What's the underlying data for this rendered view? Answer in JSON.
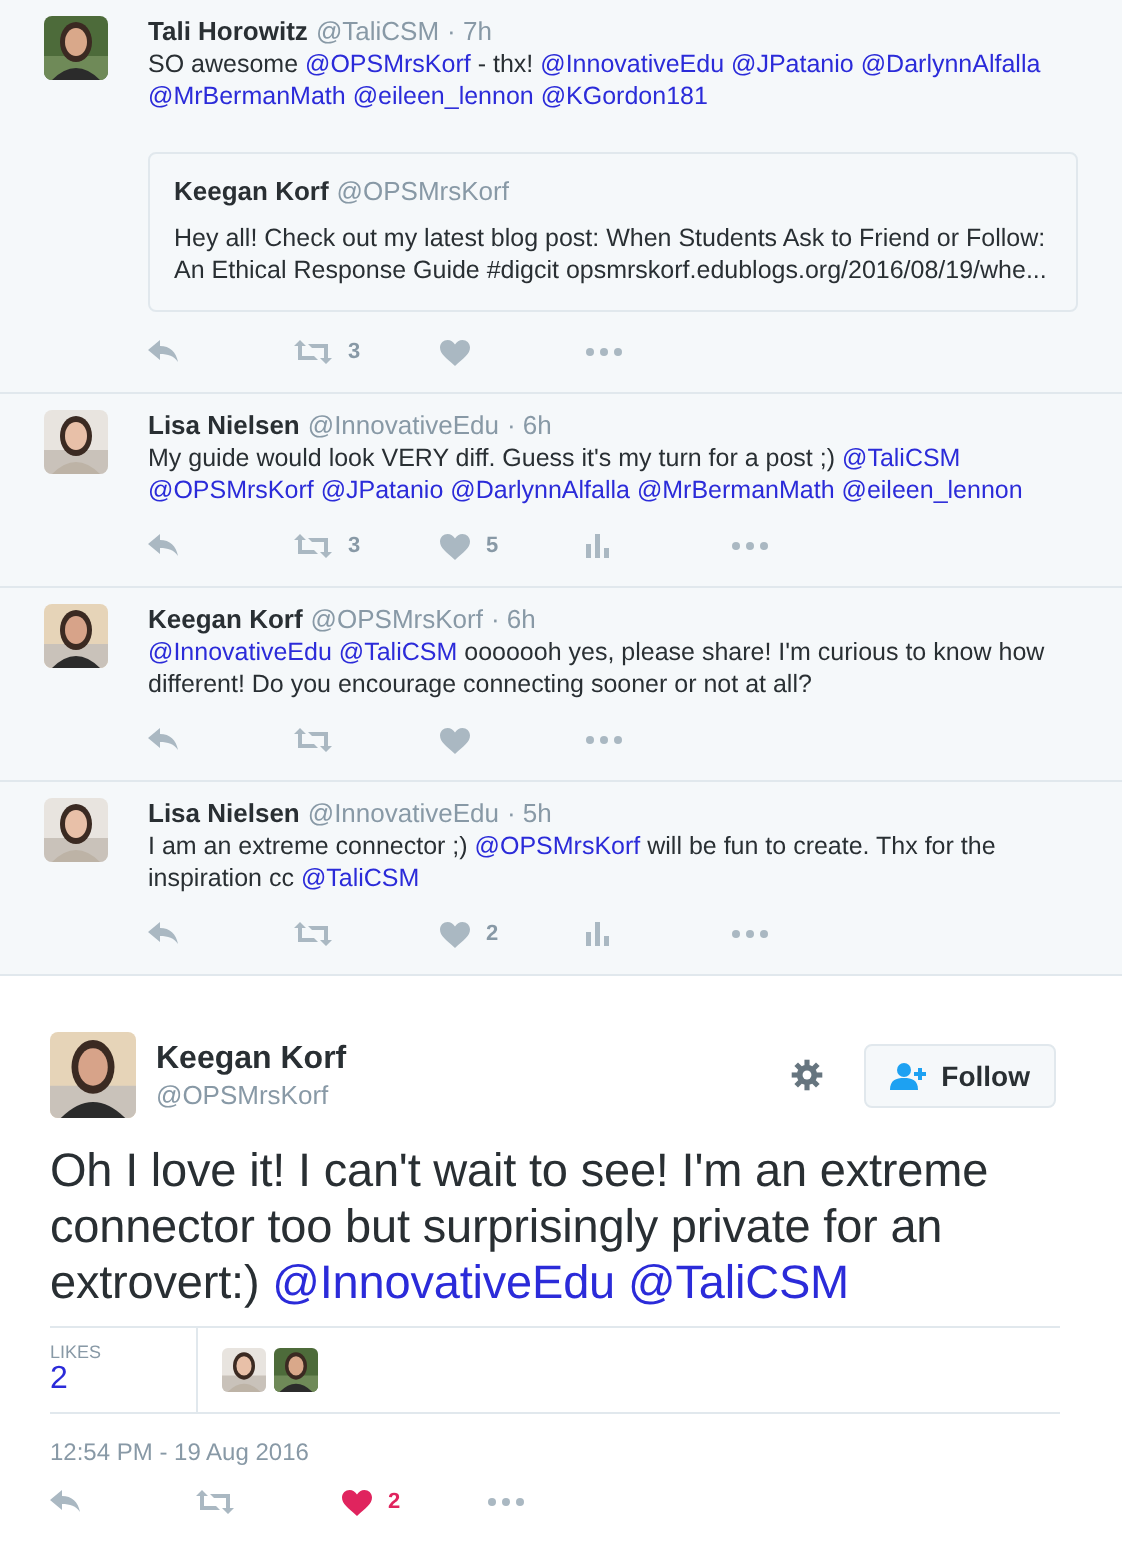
{
  "replies": [
    {
      "name": "Tali Horowitz",
      "handle": "@TaliCSM",
      "time": "· 7h",
      "avatar": {
        "kind": "picture"
      },
      "text": [
        {
          "kind": "text",
          "text": "SO awesome"
        },
        {
          "kind": "mention",
          "text": "@OPSMrsKorf"
        },
        {
          "kind": "text",
          "text": "- thx!"
        },
        {
          "kind": "mention",
          "text": "@InnovativeEdu"
        },
        {
          "kind": "mention",
          "text": "@JPatanio"
        },
        {
          "kind": "mention",
          "text": "@DarlynnAlfalla"
        },
        {
          "kind": "mention",
          "text": "@MrBermanMath"
        },
        {
          "kind": "mention",
          "text": "@eileen_lennon"
        },
        {
          "kind": "mention",
          "text": "@KGordon181"
        }
      ],
      "quote": {
        "name": "Keegan Korf",
        "handle": "@OPSMrsKorf",
        "text": "Hey all! Check out my latest blog post: When Students Ask to Friend or Follow: An Ethical Response Guide #digcit opsmrskorf.edublogs.org/2016/08/19/whe..."
      },
      "actions": [
        {
          "kind": "reply"
        },
        {
          "kind": "retweet",
          "count": "3"
        },
        {
          "kind": "like"
        },
        {
          "kind": "more"
        }
      ]
    },
    {
      "name": "Lisa Nielsen",
      "handle": "@InnovativeEdu",
      "time": "· 6h",
      "avatar": {
        "kind": "picture"
      },
      "text": [
        {
          "kind": "text",
          "text": "My guide would look VERY diff. Guess it's my turn for a post ;)"
        },
        {
          "kind": "mention",
          "text": "@TaliCSM"
        },
        {
          "kind": "mention",
          "text": "@OPSMrsKorf"
        },
        {
          "kind": "mention",
          "text": "@JPatanio"
        },
        {
          "kind": "mention",
          "text": "@DarlynnAlfalla"
        },
        {
          "kind": "mention",
          "text": "@MrBermanMath"
        },
        {
          "kind": "mention",
          "text": "@eileen_lennon"
        }
      ],
      "actions": [
        {
          "kind": "reply"
        },
        {
          "kind": "retweet",
          "count": "3"
        },
        {
          "kind": "like",
          "count": "5"
        },
        {
          "kind": "analytics"
        },
        {
          "kind": "more"
        }
      ]
    },
    {
      "name": "Keegan Korf",
      "handle": "@OPSMrsKorf",
      "time": "· 6h",
      "avatar": {
        "kind": "picture"
      },
      "text": [
        {
          "kind": "mention",
          "text": "@InnovativeEdu"
        },
        {
          "kind": "mention",
          "text": "@TaliCSM"
        },
        {
          "kind": "text",
          "text": "ooooooh yes, please share! I'm curious to know how different! Do you encourage connecting sooner or not at all?"
        }
      ],
      "actions": [
        {
          "kind": "reply"
        },
        {
          "kind": "retweet"
        },
        {
          "kind": "like"
        },
        {
          "kind": "more"
        }
      ]
    },
    {
      "name": "Lisa Nielsen",
      "handle": "@InnovativeEdu",
      "time": "· 5h",
      "avatar": {
        "kind": "picture"
      },
      "text": [
        {
          "kind": "text",
          "text": "I am an extreme connector ;)"
        },
        {
          "kind": "mention",
          "text": "@OPSMrsKorf"
        },
        {
          "kind": "text",
          "text": "will be fun to create. Thx for the inspiration cc"
        },
        {
          "kind": "mention",
          "text": "@TaliCSM"
        }
      ],
      "actions": [
        {
          "kind": "reply"
        },
        {
          "kind": "retweet"
        },
        {
          "kind": "like",
          "count": "2"
        },
        {
          "kind": "analytics"
        },
        {
          "kind": "more"
        }
      ]
    }
  ],
  "main_tweet": {
    "name": "Keegan Korf",
    "handle": "@OPSMrsKorf",
    "avatar": {
      "kind": "picture"
    },
    "follow_button": "Follow",
    "text": [
      {
        "kind": "text",
        "text": "Oh I love it! I can't wait to see! I'm an extreme connector too but surprisingly private for an extrovert:)"
      },
      {
        "kind": "mention",
        "text": "@InnovativeEdu"
      },
      {
        "kind": "mention",
        "text": "@TaliCSM"
      }
    ],
    "likes_label": "LIKES",
    "likes_count": "2",
    "likers": [
      {
        "kind": "picture"
      },
      {
        "kind": "picture"
      }
    ],
    "timestamp": "12:54 PM - 19 Aug 2016",
    "actions": [
      {
        "kind": "reply",
        "on": false
      },
      {
        "kind": "retweet",
        "on": false
      },
      {
        "kind": "like",
        "count": "2",
        "on": true
      },
      {
        "kind": "more",
        "on": false
      }
    ]
  }
}
